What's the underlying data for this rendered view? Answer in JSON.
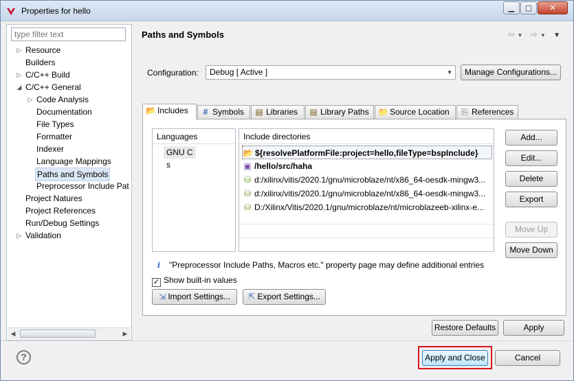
{
  "window": {
    "title": "Properties for hello"
  },
  "filter": {
    "placeholder": "type filter text"
  },
  "tree": {
    "items": [
      {
        "label": "Resource",
        "expander": "▷"
      },
      {
        "label": "Builders",
        "expander": ""
      },
      {
        "label": "C/C++ Build",
        "expander": "▷"
      },
      {
        "label": "C/C++ General",
        "expander": "◢"
      },
      {
        "label": "Code Analysis",
        "expander": "▷"
      },
      {
        "label": "Documentation",
        "expander": ""
      },
      {
        "label": "File Types",
        "expander": ""
      },
      {
        "label": "Formatter",
        "expander": ""
      },
      {
        "label": "Indexer",
        "expander": ""
      },
      {
        "label": "Language Mappings",
        "expander": ""
      },
      {
        "label": "Paths and Symbols",
        "expander": ""
      },
      {
        "label": "Preprocessor Include Pat",
        "expander": ""
      },
      {
        "label": "Project Natures",
        "expander": ""
      },
      {
        "label": "Project References",
        "expander": ""
      },
      {
        "label": "Run/Debug Settings",
        "expander": ""
      },
      {
        "label": "Validation",
        "expander": "▷"
      }
    ]
  },
  "page": {
    "title": "Paths and Symbols"
  },
  "configuration": {
    "label": "Configuration:",
    "value": "Debug  [ Active ]",
    "manage_button": "Manage Configurations..."
  },
  "tabs": [
    {
      "label": "Includes",
      "icon": "includes-icon"
    },
    {
      "label": "Symbols",
      "icon": "hash-icon"
    },
    {
      "label": "Libraries",
      "icon": "library-icon"
    },
    {
      "label": "Library Paths",
      "icon": "library-path-icon"
    },
    {
      "label": "Source Location",
      "icon": "folder-icon"
    },
    {
      "label": "References",
      "icon": "references-icon"
    }
  ],
  "languages": {
    "header": "Languages",
    "items": [
      "GNU C",
      "s"
    ]
  },
  "include_dirs": {
    "header": "Include directories",
    "items": [
      "${resolvePlatformFile:project=hello,fileType=bspInclude}",
      "/hello/src/haha",
      "d:/xilinx/vitis/2020.1/gnu/microblaze/nt/x86_64-oesdk-mingw3...",
      "d:/xilinx/vitis/2020.1/gnu/microblaze/nt/x86_64-oesdk-mingw3...",
      "D:/Xilinx/Vitis/2020.1/gnu/microblaze/nt/microblazeeb-xilinx-e..."
    ]
  },
  "side_buttons": {
    "add": "Add...",
    "edit": "Edit...",
    "delete": "Delete",
    "export": "Export",
    "move_up": "Move Up",
    "move_down": "Move Down"
  },
  "info": {
    "text": "\"Preprocessor Include Paths, Macros etc.\" property page may define additional entries"
  },
  "builtin": {
    "label": "Show built-in values",
    "checked": "✓"
  },
  "settings_buttons": {
    "import": "Import Settings...",
    "export": "Export Settings..."
  },
  "bottom_buttons": {
    "restore": "Restore Defaults",
    "apply": "Apply",
    "apply_close": "Apply and Close",
    "cancel": "Cancel"
  },
  "colors": {
    "highlight": "#d9141d",
    "selection": "#dbe7f6"
  }
}
